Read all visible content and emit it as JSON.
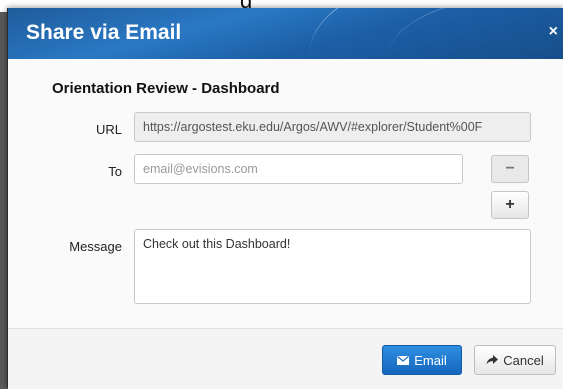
{
  "dialog": {
    "title": "Share via Email",
    "close_label": "×"
  },
  "report_title": "Orientation Review - Dashboard",
  "fields": {
    "url": {
      "label": "URL",
      "value": "https://argostest.eku.edu/Argos/AWV/#explorer/Student%00F"
    },
    "to": {
      "label": "To",
      "placeholder": "email@evisions.com"
    },
    "message": {
      "label": "Message",
      "value": "Check out this Dashboard!"
    }
  },
  "recipient_buttons": {
    "remove_label": "−",
    "add_label": "+"
  },
  "footer": {
    "email_label": "Email",
    "cancel_label": "Cancel"
  },
  "colors": {
    "header": "#1f5c9b",
    "primary": "#1a73c8"
  },
  "icons": {
    "email": "envelope-icon",
    "cancel": "forward-arrow-icon"
  }
}
